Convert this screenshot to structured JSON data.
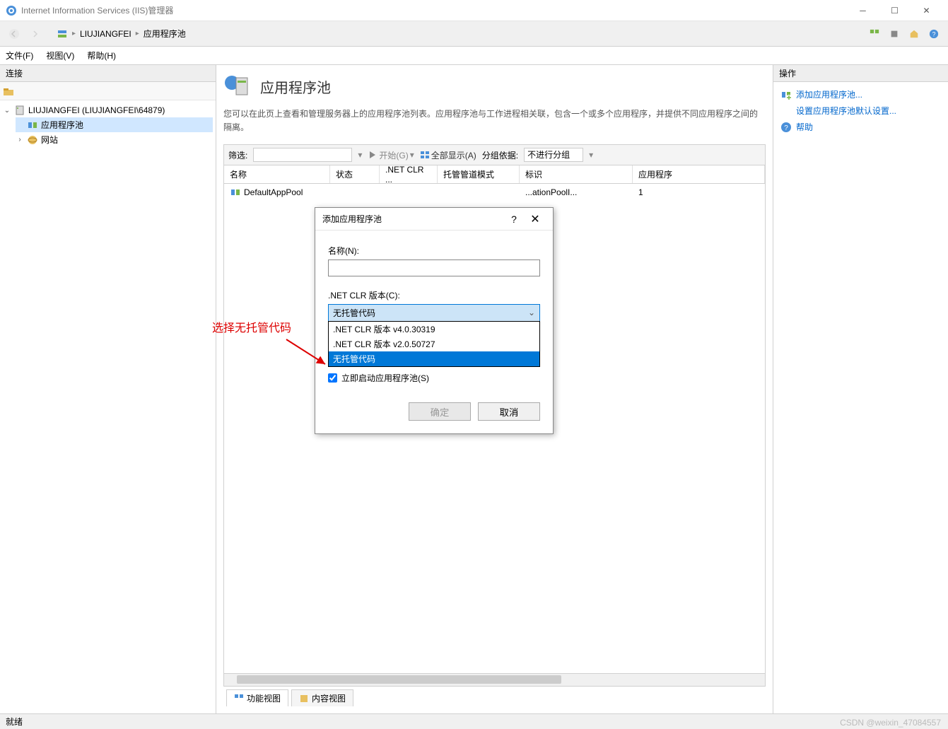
{
  "window": {
    "title": "Internet Information Services (IIS)管理器"
  },
  "breadcrumb": {
    "root": "LIUJIANGFEI",
    "current": "应用程序池"
  },
  "menu": {
    "file": "文件(F)",
    "view": "视图(V)",
    "help": "帮助(H)"
  },
  "connections": {
    "header": "连接",
    "server": "LIUJIANGFEI (LIUJIANGFEI\\64879)",
    "app_pools": "应用程序池",
    "sites": "网站"
  },
  "main": {
    "title": "应用程序池",
    "description": "您可以在此页上查看和管理服务器上的应用程序池列表。应用程序池与工作进程相关联，包含一个或多个应用程序，并提供不同应用程序之间的隔离。",
    "filter_label": "筛选:",
    "start_btn": "开始(G)",
    "show_all": "全部显示(A)",
    "group_by_label": "分组依据:",
    "group_by_value": "不进行分组",
    "columns": {
      "name": "名称",
      "status": "状态",
      "clr": ".NET CLR ...",
      "pipeline": "托管管道模式",
      "identity": "标识",
      "apps": "应用程序"
    },
    "row": {
      "name": "DefaultAppPool",
      "status": "",
      "clr": "",
      "pipeline": "",
      "identity": "...ationPoolI...",
      "apps": "1"
    },
    "view_features": "功能视图",
    "view_content": "内容视图"
  },
  "actions": {
    "header": "操作",
    "add_pool": "添加应用程序池...",
    "set_defaults": "设置应用程序池默认设置...",
    "help": "帮助"
  },
  "dialog": {
    "title": "添加应用程序池",
    "name_label": "名称(N):",
    "name_value": "",
    "clr_label": ".NET CLR 版本(C):",
    "clr_selected": "无托管代码",
    "clr_options": {
      "opt1": ".NET CLR 版本 v4.0.30319",
      "opt2": ".NET CLR 版本 v2.0.50727",
      "opt3": "无托管代码"
    },
    "start_immediately": "立即启动应用程序池(S)",
    "ok": "确定",
    "cancel": "取消"
  },
  "annotation": "选择无托管代码",
  "statusbar": "就绪",
  "watermark": "CSDN @weixin_47084557"
}
